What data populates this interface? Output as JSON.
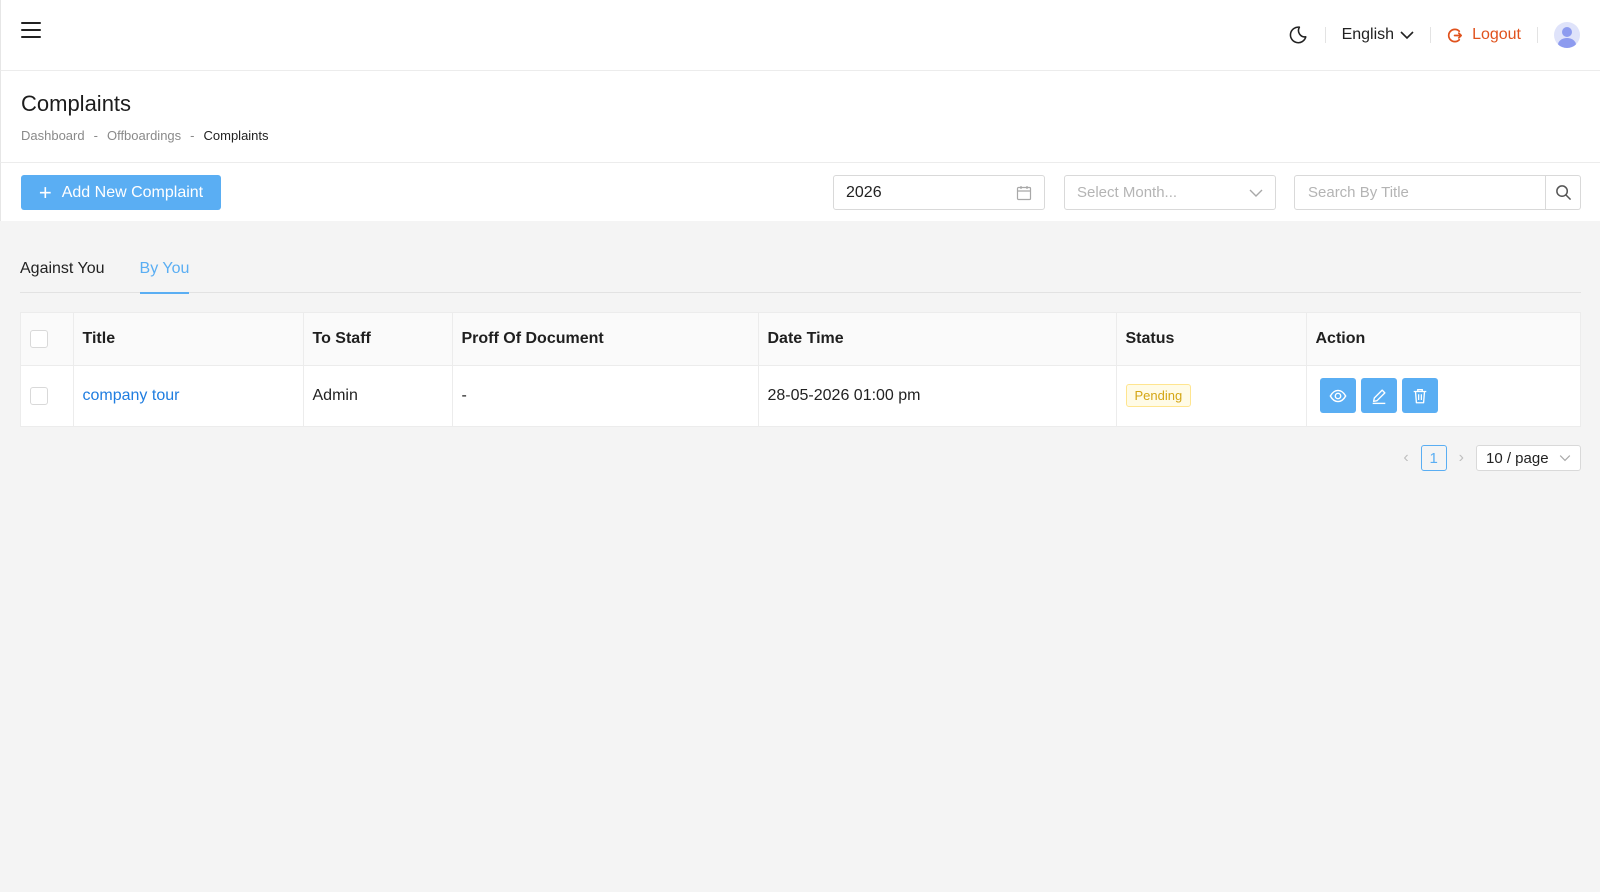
{
  "header": {
    "language": "English",
    "logout_label": "Logout"
  },
  "page": {
    "title": "Complaints",
    "breadcrumb": [
      "Dashboard",
      "-",
      "Offboardings",
      "-",
      "Complaints"
    ]
  },
  "toolbar": {
    "add_label": "Add New Complaint",
    "year_value": "2026",
    "month_placeholder": "Select Month...",
    "search_placeholder": "Search By Title"
  },
  "tabs": [
    {
      "label": "Against You",
      "active": false
    },
    {
      "label": "By You",
      "active": true
    }
  ],
  "table": {
    "columns": [
      "Title",
      "To Staff",
      "Proff Of Document",
      "Date Time",
      "Status",
      "Action"
    ],
    "rows": [
      {
        "title": "company tour",
        "to_staff": "Admin",
        "proof": "-",
        "datetime": "28-05-2026 01:00 pm",
        "status": "Pending"
      }
    ]
  },
  "pagination": {
    "current_page": "1",
    "page_size": "10 / page"
  },
  "colors": {
    "accent": "#5aaef3",
    "link": "#1f7de0",
    "logout": "#e0521d",
    "pending_text": "#d4a614",
    "pending_bg": "#fffbe6"
  },
  "icons": {
    "menu": "hamburger-icon",
    "theme": "moon-icon",
    "language_dropdown": "chevron-down-icon",
    "logout": "logout-icon",
    "user": "avatar-icon",
    "add": "plus-icon",
    "year": "calendar-icon",
    "month_dropdown": "chevron-down-icon",
    "search": "search-icon",
    "view": "eye-icon",
    "edit": "pencil-icon",
    "delete": "trash-icon"
  }
}
